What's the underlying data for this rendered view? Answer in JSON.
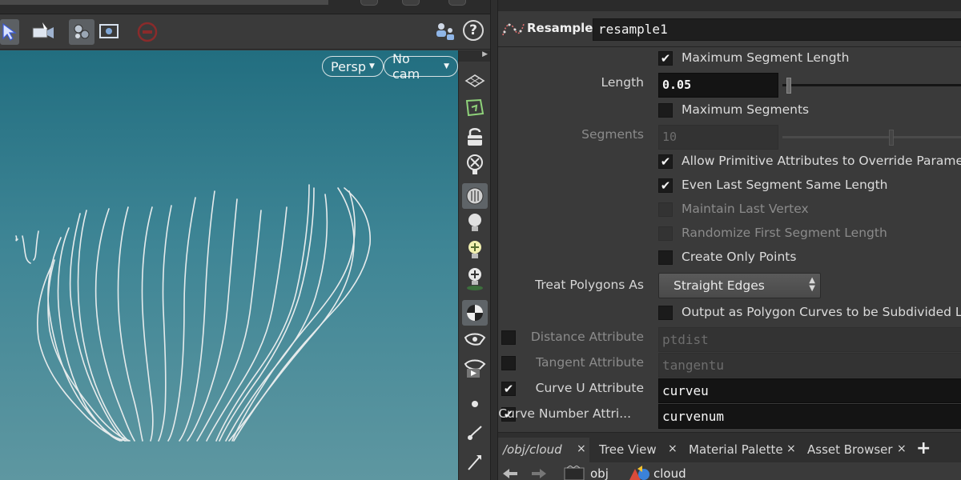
{
  "viewport": {
    "persp_label": "Persp",
    "cam_label": "No cam"
  },
  "toolbar": {
    "help_label": "?"
  },
  "node": {
    "type_label": "Resample",
    "name": "resample1"
  },
  "params": {
    "max_segment_length_label": "Maximum Segment Length",
    "max_segment_length_checked": true,
    "length_label": "Length",
    "length_value": "0.05",
    "max_segments_label": "Maximum Segments",
    "max_segments_checked": false,
    "segments_label": "Segments",
    "segments_value": "10",
    "allow_prim_attr_label": "Allow Primitive Attributes to Override Parameter",
    "allow_prim_attr_checked": true,
    "even_last_label": "Even Last Segment Same Length",
    "even_last_checked": true,
    "maintain_last_label": "Maintain Last Vertex",
    "randomize_first_label": "Randomize First Segment Length",
    "create_only_points_label": "Create Only Points",
    "treat_polygons_label": "Treat Polygons As",
    "treat_polygons_value": "Straight Edges",
    "output_poly_label": "Output as Polygon Curves to be Subdivided Later",
    "distance_attr_label": "Distance Attribute",
    "distance_attr_value": "ptdist",
    "tangent_attr_label": "Tangent Attribute",
    "tangent_attr_value": "tangentu",
    "curve_u_label": "Curve U Attribute",
    "curve_u_value": "curveu",
    "curve_num_label": "Curve Number Attri...",
    "curve_num_value": "curvenum",
    "check_mark": "✔"
  },
  "tabs": [
    {
      "label": "/obj/cloud"
    },
    {
      "label": "Tree View"
    },
    {
      "label": "Material Palette"
    },
    {
      "label": "Asset Browser"
    }
  ],
  "tab_close": "×",
  "tab_add": "+",
  "path": {
    "crumb1": "obj",
    "crumb2": "cloud"
  }
}
